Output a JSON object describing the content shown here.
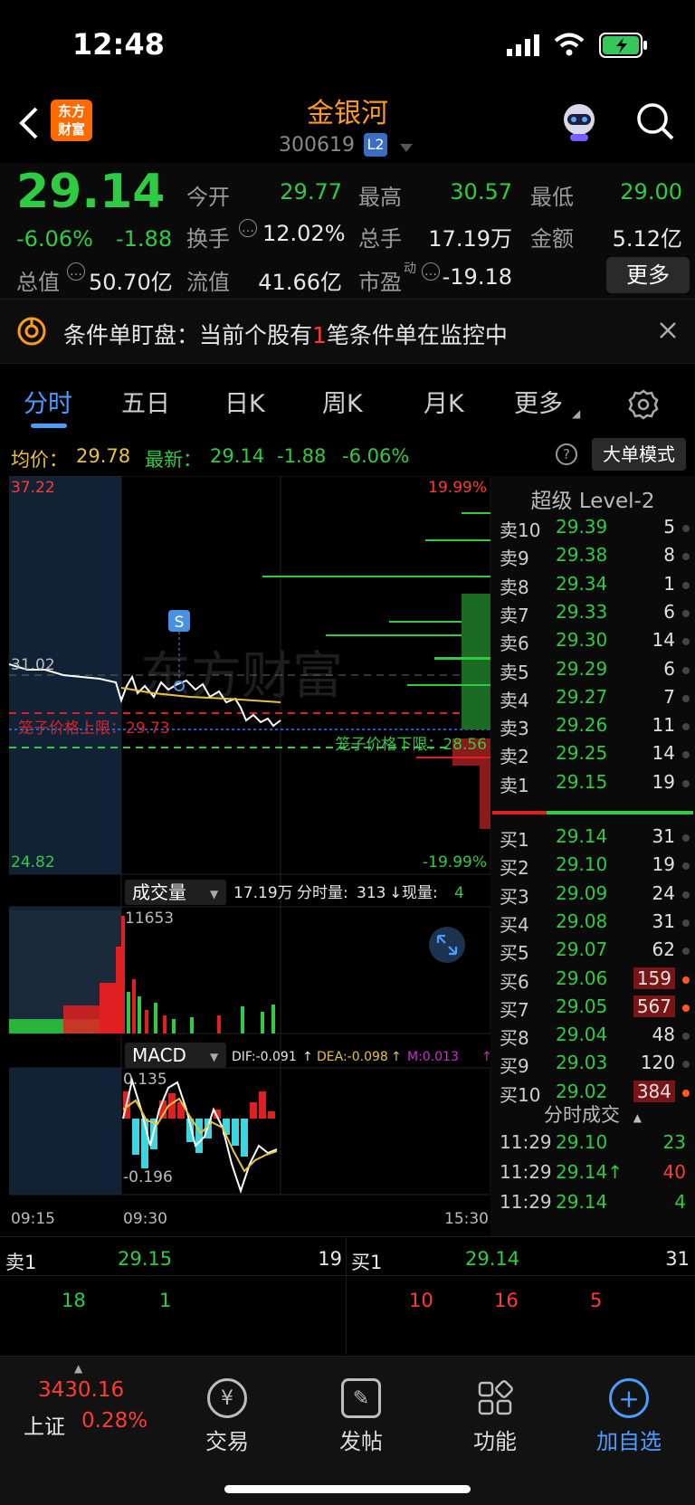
{
  "status": {
    "time": "12:48"
  },
  "header": {
    "logo_line1": "东方",
    "logo_line2": "财富",
    "stock_name": "金银河",
    "stock_code": "300619",
    "level_badge": "L2"
  },
  "quote": {
    "price": "29.14",
    "change_pct": "-6.06%",
    "change": "-1.88",
    "open_label": "今开",
    "open": "29.77",
    "high_label": "最高",
    "high": "30.57",
    "low_label": "最低",
    "low": "29.00",
    "turnover_label": "换手",
    "turnover": "12.02%",
    "volume_label": "总手",
    "volume": "17.19万",
    "amount_label": "金额",
    "amount": "5.12亿",
    "mktcap_label": "总值",
    "mktcap": "50.70亿",
    "float_label": "流值",
    "float": "41.66亿",
    "pe_label": "市盈",
    "pe_sup": "动",
    "pe": "-19.18",
    "more_label": "更多"
  },
  "banner": {
    "prefix": "条件单盯盘：当前个股有",
    "count": "1",
    "suffix": "笔条件单在监控中"
  },
  "tabs": {
    "items": [
      "分时",
      "五日",
      "日K",
      "周K",
      "月K",
      "更多"
    ],
    "active": "分时"
  },
  "infobar": {
    "avg_label": "均价：",
    "avg": "29.78",
    "last_label": "最新：",
    "last": "29.14",
    "change": "-1.88",
    "change_pct": "-6.06%",
    "mode_label": "大单模式"
  },
  "price_chart": {
    "y_top": "37.22",
    "y_mid": "31.02",
    "y_bottom": "24.82",
    "pct_top": "19.99%",
    "pct_bottom": "-19.99%",
    "cage_upper_label": "笼子价格上限：29.73",
    "cage_lower_label": "笼子价格下限：28.56",
    "marker": "S",
    "watermark": "东方财富"
  },
  "volume_chart": {
    "selector": "成交量",
    "total": "17.19万",
    "minute_label": "分时量:",
    "minute_val": "313",
    "cur_label": "现量:",
    "cur_val": "4",
    "max_val": "11653"
  },
  "macd_chart": {
    "selector": "MACD",
    "dif": "DIF:-0.091",
    "dea": "DEA:-0.098",
    "m": "M:0.013",
    "top_val": "0.135",
    "bottom_val": "-0.196"
  },
  "time_axis": {
    "t1": "09:15",
    "t2": "09:30",
    "t3": "15:30"
  },
  "level2": {
    "title": "超级 Level-2",
    "asks": [
      {
        "label": "卖10",
        "price": "29.39",
        "vol": "5"
      },
      {
        "label": "卖9",
        "price": "29.38",
        "vol": "8"
      },
      {
        "label": "卖8",
        "price": "29.34",
        "vol": "1"
      },
      {
        "label": "卖7",
        "price": "29.33",
        "vol": "6"
      },
      {
        "label": "卖6",
        "price": "29.30",
        "vol": "14"
      },
      {
        "label": "卖5",
        "price": "29.29",
        "vol": "6"
      },
      {
        "label": "卖4",
        "price": "29.27",
        "vol": "7"
      },
      {
        "label": "卖3",
        "price": "29.26",
        "vol": "11"
      },
      {
        "label": "卖2",
        "price": "29.25",
        "vol": "14"
      },
      {
        "label": "卖1",
        "price": "29.15",
        "vol": "19"
      }
    ],
    "bids": [
      {
        "label": "买1",
        "price": "29.14",
        "vol": "31"
      },
      {
        "label": "买2",
        "price": "29.10",
        "vol": "19"
      },
      {
        "label": "买3",
        "price": "29.09",
        "vol": "24"
      },
      {
        "label": "买4",
        "price": "29.08",
        "vol": "31"
      },
      {
        "label": "买5",
        "price": "29.07",
        "vol": "62"
      },
      {
        "label": "买6",
        "price": "29.06",
        "vol": "159"
      },
      {
        "label": "买7",
        "price": "29.05",
        "vol": "567"
      },
      {
        "label": "买8",
        "price": "29.04",
        "vol": "48"
      },
      {
        "label": "买9",
        "price": "29.03",
        "vol": "120"
      },
      {
        "label": "买10",
        "price": "29.02",
        "vol": "384"
      }
    ],
    "trades_title": "分时成交",
    "trades": [
      {
        "time": "11:29",
        "price": "29.10",
        "vol": "23"
      },
      {
        "time": "11:29",
        "price": "29.14↑",
        "vol": "40"
      },
      {
        "time": "11:29",
        "price": "29.14",
        "vol": "4"
      }
    ]
  },
  "bottom_quotes": {
    "sell_label": "卖1",
    "sell_price": "29.15",
    "sell_vol": "19",
    "buy_label": "买1",
    "buy_price": "29.14",
    "buy_vol": "31",
    "sell_queue": [
      "18",
      "1"
    ],
    "buy_queue": [
      "10",
      "16",
      "5"
    ]
  },
  "bottom_nav": {
    "index_value": "3430.16",
    "index_name": "上证",
    "index_change": "0.28%",
    "trade": "交易",
    "post": "发帖",
    "func": "功能",
    "add": "加自选"
  },
  "colors": {
    "up": "#ff3b30",
    "down": "#2ecc40",
    "accent": "#ff9a1a",
    "avg_line": "#e8c33a",
    "blue": "#4a90e2"
  }
}
